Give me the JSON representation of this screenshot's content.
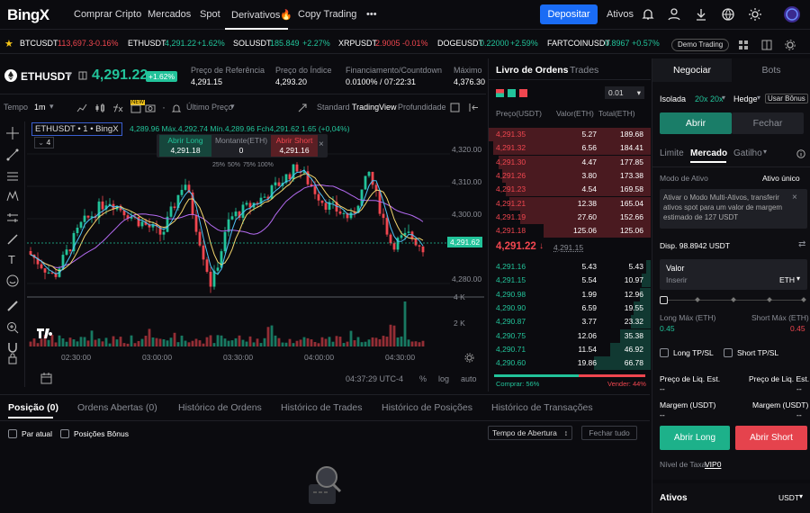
{
  "nav": {
    "logo": "BingX",
    "items": [
      "Comprar Cripto",
      "Mercados",
      "Spot",
      "Derivativos🔥",
      "Copy Trading",
      "•••"
    ],
    "deposit": "Depositar",
    "assets": "Ativos"
  },
  "ticker": [
    {
      "sym": "BTCUSDT",
      "price": "113,697.3",
      "chg": "-0.16%",
      "dir": "down"
    },
    {
      "sym": "ETHUSDT",
      "price": "4,291.22",
      "chg": "+1.62%",
      "dir": "up"
    },
    {
      "sym": "SOLUSDT",
      "price": "185.849",
      "chg": "+2.27%",
      "dir": "up"
    },
    {
      "sym": "XRPUSDT",
      "price": "2.9005",
      "chg": "-0.01%",
      "dir": "down"
    },
    {
      "sym": "DOGEUSDT",
      "price": "0.22000",
      "chg": "+2.59%",
      "dir": "up"
    },
    {
      "sym": "FARTCOINUSDT",
      "price": "0.8967",
      "chg": "+0.57%",
      "dir": "up"
    }
  ],
  "demo_trading": "Demo Trading",
  "symbol": {
    "name": "ETHUSDT",
    "price": "4,291.22",
    "change": "+1.62%",
    "ref_label": "Preço de Referência",
    "ref_value": "4,291.15",
    "index_label": "Preço do Índice",
    "index_value": "4,293.20",
    "funding_label": "Financiamento/Countdown",
    "funding_value": "0.0100% / 07:22:31",
    "max_label": "Máximo",
    "max_value": "4,376.30"
  },
  "chart_toolbar": {
    "time_label": "Tempo",
    "interval": "1m",
    "last_price": "Último Preço",
    "standard": "Standard",
    "tradingview": "TradingView",
    "depth": "Profundidade"
  },
  "chart_legend": {
    "title": "ETHUSDT • 1 • BingX",
    "ohlc": "4,289.96 Máx.4,292.74 Mín.4,289.96 Fch4,291.62 1.65 (+0,04%)",
    "count": "4",
    "long_label": "Abrir Long",
    "long_price": "4,291.18",
    "amount_label": "Montante(ETH)",
    "amount_value": "0",
    "short_label": "Abrir Short",
    "short_price": "4,291.16",
    "pcts": [
      "25%",
      "50%",
      "75%",
      "100%"
    ]
  },
  "chart_data": {
    "type": "candlestick",
    "price_ticks": [
      "4,320.00",
      "4,310.00",
      "4,300.00",
      "4,280.00"
    ],
    "current_price": "4,291.62",
    "volume_ticks": [
      "4 K",
      "2 K"
    ],
    "time_ticks": [
      "02:30:00",
      "03:00:00",
      "03:30:00",
      "04:00:00",
      "04:30:00"
    ],
    "ylim": [
      4276,
      4325
    ]
  },
  "chart_footer": {
    "clock": "04:37:29 UTC-4",
    "pct": "%",
    "log": "log",
    "auto": "auto"
  },
  "orderbook": {
    "tab_book": "Livro de Ordens",
    "tab_trades": "Trades",
    "step": "0.01",
    "col_price": "Preço(USDT)",
    "col_amount": "Valor(ETH)",
    "col_total": "Total(ETH)",
    "asks": [
      [
        "4,291.35",
        "5.27",
        "189.68"
      ],
      [
        "4,291.32",
        "6.56",
        "184.41"
      ],
      [
        "4,291.30",
        "4.47",
        "177.85"
      ],
      [
        "4,291.26",
        "3.80",
        "173.38"
      ],
      [
        "4,291.23",
        "4.54",
        "169.58"
      ],
      [
        "4,291.21",
        "12.38",
        "165.04"
      ],
      [
        "4,291.19",
        "27.60",
        "152.66"
      ],
      [
        "4,291.18",
        "125.06",
        "125.06"
      ]
    ],
    "mid_price": "4,291.22",
    "mid_ref": "4,291.15",
    "bids": [
      [
        "4,291.16",
        "5.43",
        "5.43"
      ],
      [
        "4,291.15",
        "5.54",
        "10.97"
      ],
      [
        "4,290.98",
        "1.99",
        "12.96"
      ],
      [
        "4,290.90",
        "6.59",
        "19.55"
      ],
      [
        "4,290.87",
        "3.77",
        "23.32"
      ],
      [
        "4,290.75",
        "12.06",
        "35.38"
      ],
      [
        "4,290.71",
        "11.54",
        "46.92"
      ],
      [
        "4,290.60",
        "19.86",
        "66.78"
      ]
    ],
    "buy_ratio": "Comprar: 56%",
    "sell_ratio": "Vender: 44%"
  },
  "panel": {
    "tab_trade": "Negociar",
    "tab_bots": "Bots",
    "isolated": "Isolada",
    "leverage": "20x 20x",
    "hedge": "Hedge",
    "bonus": "Usar Bônus",
    "open": "Abrir",
    "close": "Fechar",
    "order_limit": "Limite",
    "order_market": "Mercado",
    "order_trigger": "Gatilho",
    "asset_mode_label": "Modo de Ativo",
    "asset_mode_value": "Ativo único",
    "notice": "Ativar o Modo Multi-Ativos, transferir ativos spot para um valor de margem estimado de 127 USDT",
    "available": "Disp. 98.8942 USDT",
    "value_label": "Valor",
    "value_placeholder": "Inserir",
    "value_unit": "ETH",
    "long_max_label": "Long Máx (ETH)",
    "long_max": "0.45",
    "short_max_label": "Short Máx (ETH)",
    "short_max": "0.45",
    "long_tpsl": "Long TP/SL",
    "short_tpsl": "Short TP/SL",
    "liq_label": "Preço de Liq. Est.",
    "liq_value": "--",
    "margin_label": "Margem (USDT)",
    "margin_value": "--",
    "btn_long": "Abrir Long",
    "btn_short": "Abrir Short",
    "fee_label": "Nível de Taxa",
    "fee_value": "VIP0",
    "assets_label": "Ativos",
    "assets_currency": "USDT"
  },
  "bottom": {
    "tabs": [
      "Posição (0)",
      "Ordens Abertas (0)",
      "Histórico de Ordens",
      "Histórico de Trades",
      "Histórico de Posições",
      "Histórico de Transações"
    ],
    "current_pair": "Par atual",
    "bonus_positions": "Posições Bônus",
    "sort_select": "Tempo de Abertura",
    "close_all": "Fechar tudo"
  }
}
